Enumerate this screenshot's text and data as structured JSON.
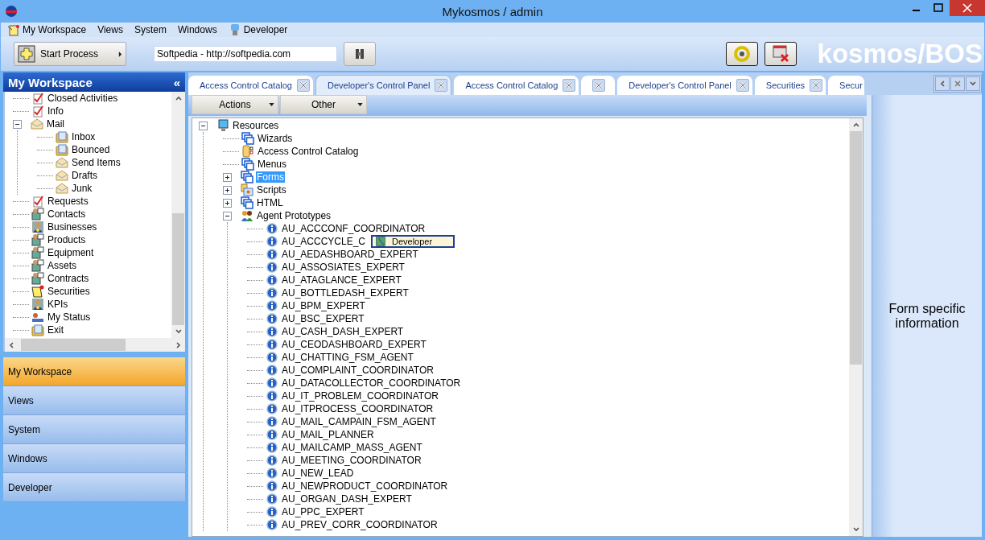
{
  "window": {
    "title": "Mykosmos / admin"
  },
  "menu": [
    {
      "label": "My Workspace",
      "kind": "workspace"
    },
    {
      "label": "Views",
      "kind": "plain"
    },
    {
      "label": "System",
      "kind": "plain"
    },
    {
      "label": "Windows",
      "kind": "plain"
    },
    {
      "label": "Developer",
      "kind": "developer"
    }
  ],
  "toolbar": {
    "start_button": "Start Process",
    "address": "Softpedia - http://softpedia.com",
    "brand": "kosmos/BOS"
  },
  "sidebar": {
    "title": "My Workspace",
    "collapse": "«",
    "tree": [
      {
        "label": "Closed Activities",
        "kind": "check",
        "selected": false
      },
      {
        "label": "Info",
        "kind": "check",
        "selected": false
      },
      {
        "label": "Mail",
        "kind": "mail",
        "expanded": true,
        "selected": false,
        "children": [
          {
            "label": "Inbox",
            "kind": "folder",
            "selected": false
          },
          {
            "label": "Bounced",
            "kind": "folder",
            "selected": false
          },
          {
            "label": "Send Items",
            "kind": "mail",
            "selected": false
          },
          {
            "label": "Drafts",
            "kind": "mail",
            "selected": false
          },
          {
            "label": "Junk",
            "kind": "mail",
            "selected": false
          }
        ]
      },
      {
        "label": "Requests",
        "kind": "check",
        "selected": false
      },
      {
        "label": "Contacts",
        "kind": "card",
        "selected": false
      },
      {
        "label": "Businesses",
        "kind": "badge",
        "selected": false
      },
      {
        "label": "Products",
        "kind": "card",
        "selected": false
      },
      {
        "label": "Equipment",
        "kind": "card",
        "selected": false
      },
      {
        "label": "Assets",
        "kind": "card",
        "selected": false
      },
      {
        "label": "Contracts",
        "kind": "card",
        "selected": false
      },
      {
        "label": "Securities",
        "kind": "cert",
        "selected": false
      },
      {
        "label": "KPIs",
        "kind": "badge",
        "selected": false
      },
      {
        "label": "My Status",
        "kind": "status",
        "selected": false
      },
      {
        "label": "Exit",
        "kind": "folder",
        "selected": false
      }
    ],
    "nav": [
      {
        "label": "My Workspace",
        "selected": true
      },
      {
        "label": "Views",
        "selected": false
      },
      {
        "label": "System",
        "selected": false
      },
      {
        "label": "Windows",
        "selected": false
      },
      {
        "label": "Developer",
        "selected": false
      }
    ]
  },
  "tabs": [
    {
      "label": "Access Control Catalog",
      "selected": false
    },
    {
      "label": "Developer's Control Panel",
      "selected": true
    },
    {
      "label": "Access Control Catalog",
      "selected": false
    },
    {
      "selected": false
    },
    {
      "label": "Developer's Control Panel",
      "selected": false
    },
    {
      "label": "Securities",
      "selected": false
    },
    {
      "label": "Secur",
      "selected": false
    }
  ],
  "actions": [
    "Actions",
    "Other"
  ],
  "tree": [
    {
      "label": "Resources",
      "kind": "monitor",
      "expanded": true,
      "selected": false,
      "children": [
        {
          "label": "Wizards",
          "kind": "windows",
          "selected": false
        },
        {
          "label": "Access Control Catalog",
          "kind": "catalog",
          "selected": false
        },
        {
          "label": "Menus",
          "kind": "windows",
          "selected": false
        },
        {
          "label": "Forms",
          "kind": "windows",
          "expanded": false,
          "selected": true
        },
        {
          "label": "Scripts",
          "kind": "script",
          "expanded": false,
          "selected": false
        },
        {
          "label": "HTML",
          "kind": "windows",
          "expanded": false,
          "selected": false
        },
        {
          "label": "Agent Prototypes",
          "kind": "agents",
          "expanded": true,
          "selected": false,
          "children": [
            {
              "label": "AU_ACCCONF_COORDINATOR",
              "kind": "agent",
              "selected": false
            },
            {
              "label": "AU_ACCCYCLE_C",
              "kind": "agent",
              "selected": false
            },
            {
              "label": "AU_AEDASHBOARD_EXPERT",
              "kind": "agent",
              "selected": false
            },
            {
              "label": "AU_ASSOSIATES_EXPERT",
              "kind": "agent",
              "selected": false
            },
            {
              "label": "AU_ATAGLANCE_EXPERT",
              "kind": "agent",
              "selected": false
            },
            {
              "label": "AU_BOTTLEDASH_EXPERT",
              "kind": "agent",
              "selected": false
            },
            {
              "label": "AU_BPM_EXPERT",
              "kind": "agent",
              "selected": false
            },
            {
              "label": "AU_BSC_EXPERT",
              "kind": "agent",
              "selected": false
            },
            {
              "label": "AU_CASH_DASH_EXPERT",
              "kind": "agent",
              "selected": false
            },
            {
              "label": "AU_CEODASHBOARD_EXPERT",
              "kind": "agent",
              "selected": false
            },
            {
              "label": "AU_CHATTING_FSM_AGENT",
              "kind": "agent",
              "selected": false
            },
            {
              "label": "AU_COMPLAINT_COORDINATOR",
              "kind": "agent",
              "selected": false
            },
            {
              "label": "AU_DATACOLLECTOR_COORDINATOR",
              "kind": "agent",
              "selected": false
            },
            {
              "label": "AU_IT_PROBLEM_COORDINATOR",
              "kind": "agent",
              "selected": false
            },
            {
              "label": "AU_ITPROCESS_COORDINATOR",
              "kind": "agent",
              "selected": false
            },
            {
              "label": "AU_MAIL_CAMPAIN_FSM_AGENT",
              "kind": "agent",
              "selected": false
            },
            {
              "label": "AU_MAIL_PLANNER",
              "kind": "agent",
              "selected": false
            },
            {
              "label": "AU_MAILCAMP_MASS_AGENT",
              "kind": "agent",
              "selected": false
            },
            {
              "label": "AU_MEETING_COORDINATOR",
              "kind": "agent",
              "selected": false
            },
            {
              "label": "AU_NEW_LEAD",
              "kind": "agent",
              "selected": false
            },
            {
              "label": "AU_NEWPRODUCT_COORDINATOR",
              "kind": "agent",
              "selected": false
            },
            {
              "label": "AU_ORGAN_DASH_EXPERT",
              "kind": "agent",
              "selected": false
            },
            {
              "label": "AU_PPC_EXPERT",
              "kind": "agent",
              "selected": false
            },
            {
              "label": "AU_PREV_CORR_COORDINATOR",
              "kind": "agent",
              "selected": false
            }
          ]
        }
      ]
    }
  ],
  "popup": {
    "label": "Developer"
  },
  "info_panel": {
    "text": "Form specific information"
  }
}
